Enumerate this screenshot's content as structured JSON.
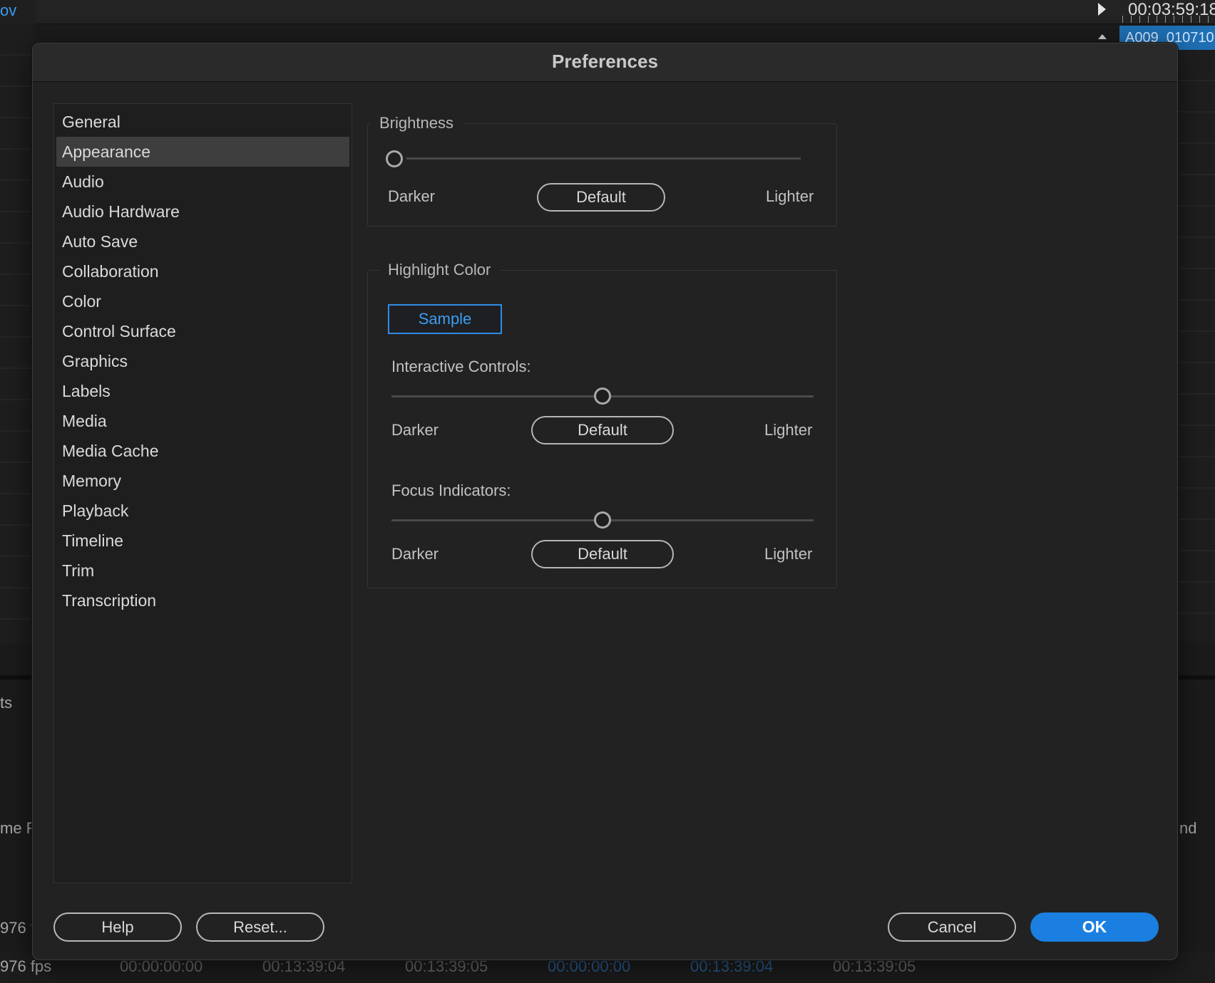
{
  "background": {
    "top_left_text": "ov",
    "timecode": "00:03:59:18",
    "clip_name": "A009_010710",
    "side_labels": [
      "ts",
      "me R",
      "976 f",
      "976 fps",
      "nd"
    ],
    "bottom_timecodes": [
      "00:00:00:00",
      "00:13:39:04",
      "00:13:39:05",
      "00:00:00:00",
      "00:13:39:04",
      "00:13:39:05"
    ]
  },
  "dialog": {
    "title": "Preferences",
    "categories": [
      "General",
      "Appearance",
      "Audio",
      "Audio Hardware",
      "Auto Save",
      "Collaboration",
      "Color",
      "Control Surface",
      "Graphics",
      "Labels",
      "Media",
      "Media Cache",
      "Memory",
      "Playback",
      "Timeline",
      "Trim",
      "Transcription"
    ],
    "selected_category": "Appearance",
    "brightness": {
      "title": "Brightness",
      "darker": "Darker",
      "default": "Default",
      "lighter": "Lighter",
      "level": 0.0
    },
    "highlight": {
      "title": "Highlight Color",
      "sample": "Sample",
      "interactive_controls": {
        "label": "Interactive Controls:",
        "darker": "Darker",
        "default": "Default",
        "lighter": "Lighter",
        "level": 0.5
      },
      "focus_indicators": {
        "label": "Focus Indicators:",
        "darker": "Darker",
        "default": "Default",
        "lighter": "Lighter",
        "level": 0.5
      }
    },
    "footer": {
      "help": "Help",
      "reset": "Reset...",
      "cancel": "Cancel",
      "ok": "OK"
    }
  },
  "colors": {
    "accent": "#1a7fe0",
    "sample_outline": "#2f8de4",
    "selection": "#3e3e3e"
  }
}
